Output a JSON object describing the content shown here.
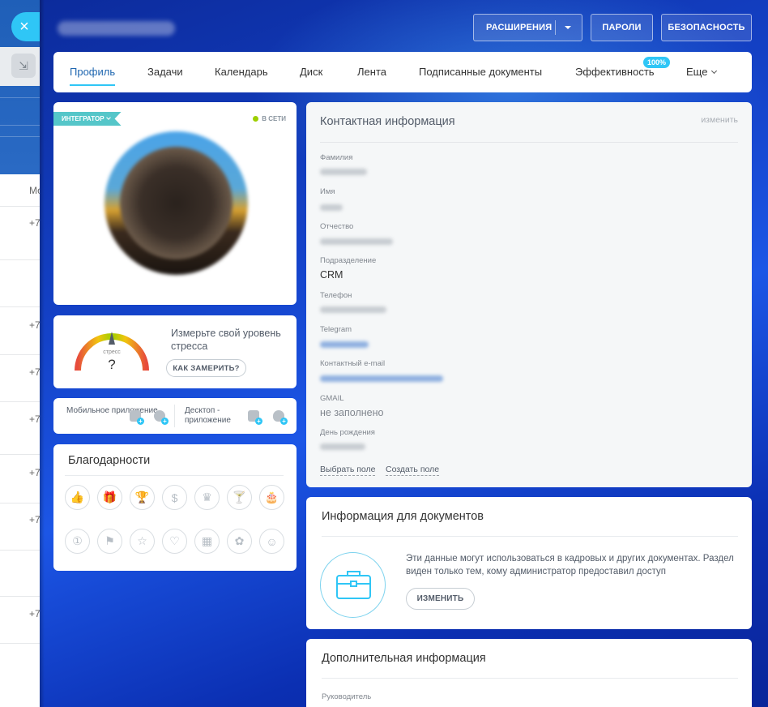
{
  "background": {
    "close_icon": "×",
    "collapse_icon": "⇲",
    "column_label": "Мо",
    "row_prefixes": [
      "+7",
      "+7",
      "+7",
      "+7",
      "+7",
      "+7",
      "+7"
    ]
  },
  "header": {
    "buttons": {
      "extensions": "РАСШИРЕНИЯ",
      "passwords": "ПАРОЛИ",
      "security": "БЕЗОПАСНОСТЬ"
    }
  },
  "tabs": {
    "items": [
      {
        "label": "Профиль",
        "active": true
      },
      {
        "label": "Задачи"
      },
      {
        "label": "Календарь"
      },
      {
        "label": "Диск"
      },
      {
        "label": "Лента"
      },
      {
        "label": "Подписанные документы"
      },
      {
        "label": "Эффективность"
      },
      {
        "label": "Еще"
      }
    ],
    "efficiency_badge": "100%"
  },
  "profile": {
    "role_badge": "ИНТЕГРАТОР",
    "status": "В СЕТИ",
    "status_color": "#9dcf00"
  },
  "stress": {
    "gauge_label": "стресс",
    "gauge_value": "?",
    "prompt": "Измерьте свой уровень стресса",
    "button": "КАК ЗАМЕРИТЬ?"
  },
  "apps": {
    "mobile_label": "Мобильное приложение",
    "desktop_label": "Десктоп - приложение",
    "icons": [
      "android-icon",
      "appstore-icon",
      "windows-icon",
      "apple-icon"
    ]
  },
  "thanks": {
    "title": "Благодарности",
    "icons": [
      "👍",
      "🎁",
      "🏆",
      "$",
      "♛",
      "🍸",
      "🎂",
      "①",
      "⚑",
      "☆",
      "♡",
      "▦",
      "✿",
      "☺"
    ]
  },
  "contact": {
    "title": "Контактная информация",
    "edit": "изменить",
    "fields": [
      {
        "label": "Фамилия",
        "value": ""
      },
      {
        "label": "Имя",
        "value": ""
      },
      {
        "label": "Отчество",
        "value": ""
      },
      {
        "label": "Подразделение",
        "value": "CRM"
      },
      {
        "label": "Телефон",
        "value": ""
      },
      {
        "label": "Telegram",
        "value": ""
      },
      {
        "label": "Контактный e-mail",
        "value": ""
      },
      {
        "label": "GMAIL",
        "value": "не заполнено"
      },
      {
        "label": "День рождения",
        "value": ""
      }
    ],
    "links": {
      "choose": "Выбрать поле",
      "create": "Создать поле"
    }
  },
  "documents": {
    "title": "Информация для документов",
    "text": "Эти данные могут использоваться в кадровых и других документах. Раздел виден только тем, кому администратор предоставил доступ",
    "button": "ИЗМЕНИТЬ",
    "accent": "#7ed3ee"
  },
  "additional": {
    "title": "Дополнительная информация",
    "manager_label": "Руководитель"
  },
  "colors": {
    "accent": "#2fc6f6",
    "active_tab": "#2067b0",
    "role_badge": "#55c6c9"
  }
}
